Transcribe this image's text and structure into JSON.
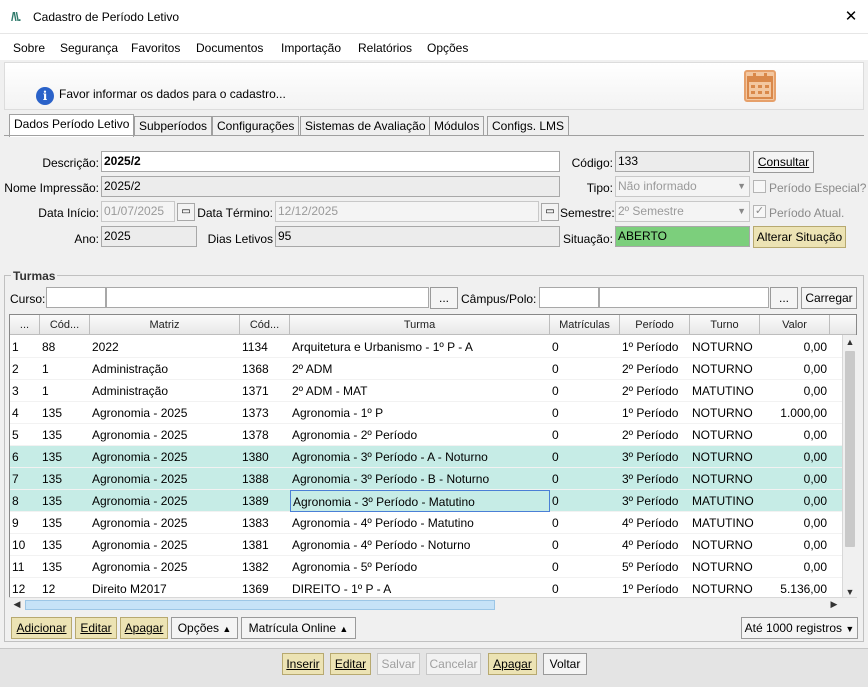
{
  "window": {
    "title": "Cadastro de Período Letivo",
    "logo": "/\\\\."
  },
  "menu": [
    "Sobre",
    "Segurança",
    "Favoritos",
    "Documentos",
    "Importação",
    "Relatórios",
    "Opções"
  ],
  "info": {
    "text": "Favor informar os dados para o cadastro..."
  },
  "tabs": [
    "Dados Período Letivo",
    "Subperíodos",
    "Configurações",
    "Sistemas de Avaliação",
    "Módulos",
    "Configs. LMS"
  ],
  "form": {
    "descricao_label": "Descrição:",
    "descricao_value": "2025/2",
    "nome_impressao_label": "Nome Impressão:",
    "nome_impressao_value": "2025/2",
    "data_inicio_label": "Data Início:",
    "data_inicio_value": "01/07/2025",
    "data_termino_label": "Data Término:",
    "data_termino_value": "12/12/2025",
    "ano_label": "Ano:",
    "ano_value": "2025",
    "dias_letivos_label": "Dias Letivos",
    "dias_letivos_value": "95",
    "codigo_label": "Código:",
    "codigo_value": "133",
    "tipo_label": "Tipo:",
    "tipo_value": "Não informado",
    "semestre_label": "Semestre:",
    "semestre_value": "2º Semestre",
    "situacao_label": "Situação:",
    "situacao_value": "ABERTO",
    "consultar_label": "Consultar",
    "periodo_especial_label": "Período Especial?",
    "periodo_atual_label": "Período Atual.",
    "alterar_situacao_label": "Alterar Situação",
    "situacao_color": "#7ccf7c"
  },
  "turmas": {
    "title": "Turmas",
    "curso_label": "Curso:",
    "campus_label": "Câmpus/Polo:",
    "ellipsis": "...",
    "carregar_label": "Carregar",
    "columns": [
      "...",
      "Cód...",
      "Matriz",
      "Cód...",
      "Turma",
      "Matrículas",
      "Período",
      "Turno",
      "Valor"
    ],
    "rows": [
      [
        "1",
        "88",
        "2022",
        "1134",
        "Arquitetura e Urbanismo - 1º P - A",
        "0",
        "1º Período",
        "NOTURNO",
        "0,00"
      ],
      [
        "2",
        "1",
        "Administração",
        "1368",
        "2º ADM",
        "0",
        "2º Período",
        "NOTURNO",
        "0,00"
      ],
      [
        "3",
        "1",
        "Administração",
        "1371",
        "2º ADM - MAT",
        "0",
        "2º Período",
        "MATUTINO",
        "0,00"
      ],
      [
        "4",
        "135",
        "Agronomia - 2025",
        "1373",
        "Agronomia - 1º P",
        "0",
        "1º Período",
        "NOTURNO",
        "1.000,00"
      ],
      [
        "5",
        "135",
        "Agronomia - 2025",
        "1378",
        "Agronomia - 2º Período",
        "0",
        "2º Período",
        "NOTURNO",
        "0,00"
      ],
      [
        "6",
        "135",
        "Agronomia - 2025",
        "1380",
        "Agronomia - 3º Período - A - Noturno",
        "0",
        "3º Período",
        "NOTURNO",
        "0,00"
      ],
      [
        "7",
        "135",
        "Agronomia - 2025",
        "1388",
        "Agronomia - 3º Período - B - Noturno",
        "0",
        "3º Período",
        "NOTURNO",
        "0,00"
      ],
      [
        "8",
        "135",
        "Agronomia - 2025",
        "1389",
        "Agronomia - 3º Período - Matutino",
        "0",
        "3º Período",
        "MATUTINO",
        "0,00"
      ],
      [
        "9",
        "135",
        "Agronomia - 2025",
        "1383",
        "Agronomia - 4º Período - Matutino",
        "0",
        "4º Período",
        "MATUTINO",
        "0,00"
      ],
      [
        "10",
        "135",
        "Agronomia - 2025",
        "1381",
        "Agronomia - 4º Período - Noturno",
        "0",
        "4º Período",
        "NOTURNO",
        "0,00"
      ],
      [
        "11",
        "135",
        "Agronomia - 2025",
        "1382",
        "Agronomia - 5º Período",
        "0",
        "5º Período",
        "NOTURNO",
        "0,00"
      ],
      [
        "12",
        "12",
        "Direito M2017",
        "1369",
        "DIREITO - 1º P - A",
        "0",
        "1º Período",
        "NOTURNO",
        "5.136,00"
      ]
    ],
    "highlight_rows": [
      6,
      7,
      8
    ],
    "highlight_color": "#c6ece6",
    "actions": {
      "adicionar": "Adicionar",
      "editar": "Editar",
      "apagar": "Apagar",
      "opcoes": "Opções",
      "matricula_online": "Matrícula Online",
      "registros": "Até 1000 registros"
    }
  },
  "bottom": {
    "inserir": "Inserir",
    "editar": "Editar",
    "salvar": "Salvar",
    "cancelar": "Cancelar",
    "apagar": "Apagar",
    "voltar": "Voltar"
  },
  "icons": [
    "app-logo-icon",
    "close-icon",
    "info-icon",
    "calendar-icon",
    "calendar-picker-icon",
    "chevron-down-icon",
    "chevron-up-icon",
    "scroll-arrow-icon"
  ]
}
